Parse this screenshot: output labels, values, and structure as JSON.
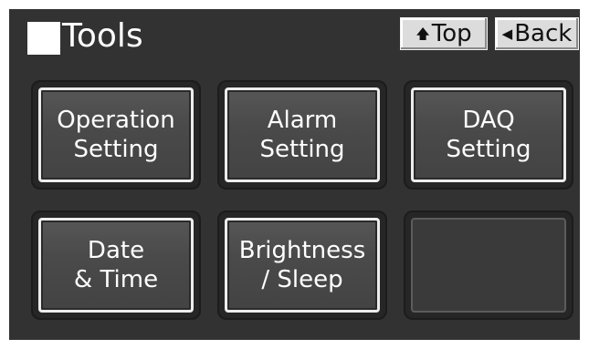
{
  "header": {
    "title": "Tools",
    "top_label": "Top",
    "back_label": "Back",
    "top_icon": "up-arrow-icon",
    "back_icon": "left-triangle-icon"
  },
  "tiles": [
    {
      "line1": "Operation",
      "line2": "Setting"
    },
    {
      "line1": "Alarm",
      "line2": "Setting"
    },
    {
      "line1": "DAQ",
      "line2": "Setting"
    },
    {
      "line1": "Date",
      "line2": "& Time"
    },
    {
      "line1": "Brightness",
      "line2": "/ Sleep"
    }
  ],
  "colors": {
    "screen_bg": "#323232",
    "button_face": "#484848",
    "button_border": "#ececec",
    "nav_button": "#dcdcdc"
  }
}
